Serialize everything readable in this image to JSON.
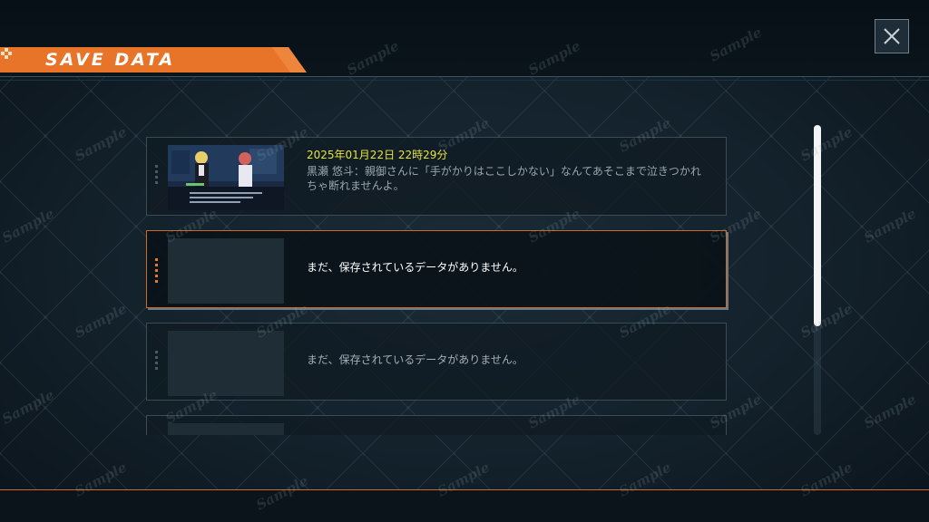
{
  "header": {
    "title": "SAVE DATA",
    "accent_color": "#e8742a"
  },
  "close_button": {
    "icon": "close-icon"
  },
  "slots": [
    {
      "state": "filled",
      "date": "2025年01月22日 22時29分",
      "summary": "黒瀬 悠斗：親御さんに「手がかりはここしかない」なんてあそこまで泣きつかれちゃ断れませんよ。",
      "thumbnail": "scene-thumbnail"
    },
    {
      "state": "empty",
      "selected": true,
      "text": "まだ、保存されているデータがありません。"
    },
    {
      "state": "empty",
      "text": "まだ、保存されているデータがありません。"
    },
    {
      "state": "empty",
      "text": ""
    }
  ],
  "scrollbar": {
    "position": 0.0,
    "visible_fraction": 0.65
  },
  "watermark": "Sample",
  "colors": {
    "date": "#e8e23a",
    "selected_border": "#c86a2a",
    "background": "#13212b"
  }
}
